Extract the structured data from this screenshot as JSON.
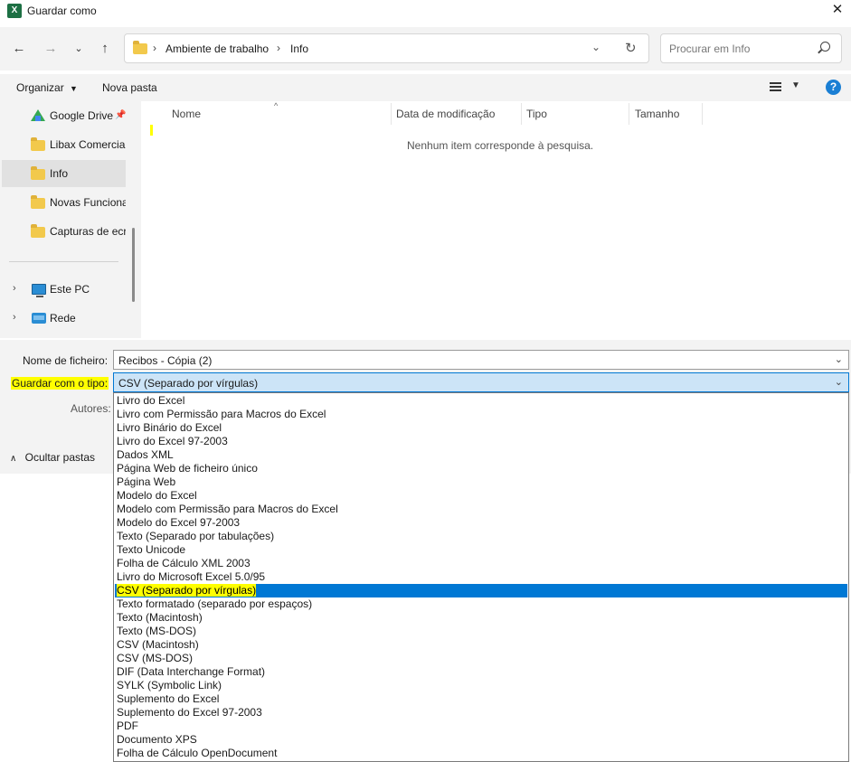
{
  "window": {
    "title": "Guardar como",
    "app_icon": "excel-icon"
  },
  "address": {
    "crumbs": [
      "Ambiente de trabalho",
      "Info"
    ],
    "search_placeholder": "Procurar em Info"
  },
  "toolbar": {
    "organize_label": "Organizar",
    "new_folder_label": "Nova pasta"
  },
  "sidebar": {
    "items": [
      {
        "label": "Google Drive",
        "icon": "google-drive-icon"
      },
      {
        "label": "Libax Comercial",
        "icon": "folder-icon"
      },
      {
        "label": "Info",
        "icon": "folder-icon"
      },
      {
        "label": "Novas Funcionalidades",
        "icon": "folder-icon"
      },
      {
        "label": "Capturas de ecrã",
        "icon": "folder-icon"
      }
    ],
    "this_pc": "Este PC",
    "network": "Rede"
  },
  "filelist": {
    "columns": [
      "Nome",
      "Data de modificação",
      "Tipo",
      "Tamanho"
    ],
    "empty_message": "Nenhum item corresponde à pesquisa."
  },
  "form": {
    "filename_label": "Nome de ficheiro:",
    "filename_value": "Recibos - Cópia (2)",
    "type_label": "Guardar com o tipo:",
    "type_value": "CSV (Separado por vírgulas)",
    "authors_label": "Autores:",
    "hide_folders_label": "Ocultar pastas"
  },
  "type_options": [
    "Livro do Excel",
    "Livro com Permissão para Macros do Excel",
    "Livro Binário do Excel",
    "Livro do Excel 97-2003",
    "Dados XML",
    "Página Web de ficheiro único",
    "Página Web",
    "Modelo do Excel",
    "Modelo com Permissão para Macros do Excel",
    "Modelo do Excel 97-2003",
    "Texto (Separado por tabulações)",
    "Texto Unicode",
    "Folha de Cálculo XML 2003",
    "Livro do Microsoft Excel 5.0/95",
    "CSV (Separado por vírgulas)",
    "Texto formatado (separado por espaços)",
    "Texto (Macintosh)",
    "Texto (MS-DOS)",
    "CSV (Macintosh)",
    "CSV (MS-DOS)",
    "DIF (Data Interchange Format)",
    "SYLK (Symbolic Link)",
    "Suplemento do Excel",
    "Suplemento do Excel 97-2003",
    "PDF",
    "Documento XPS",
    "Folha de Cálculo OpenDocument"
  ],
  "selected_type_index": 14,
  "colors": {
    "accent": "#0078d4",
    "highlight": "#ffff00",
    "chrome": "#f3f3f3"
  }
}
